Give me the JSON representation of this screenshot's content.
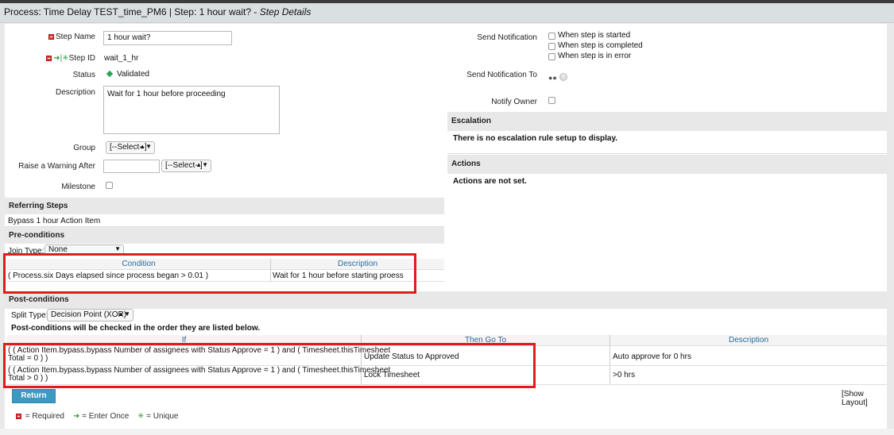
{
  "title": {
    "main": "Process: Time Delay TEST_time_PM6 | Step: 1 hour wait? - ",
    "sub": "Step Details"
  },
  "form": {
    "step_name_label": "Step Name",
    "step_name_value": "1 hour wait?",
    "step_id_label": "Step ID",
    "step_id_value": "wait_1_hr",
    "status_label": "Status",
    "status_value": "Validated",
    "description_label": "Description",
    "description_value": "Wait for 1 hour before proceeding",
    "group_label": "Group",
    "group_value": "[--Select--]",
    "raise_warning_label": "Raise a Warning After",
    "raise_warning_unit": "[--Select--]",
    "milestone_label": "Milestone"
  },
  "right": {
    "send_notification_label": "Send Notification",
    "notify_options": [
      "When step is started",
      "When step is completed",
      "When step is in error"
    ],
    "send_notification_to_label": "Send Notification To",
    "notify_owner_label": "Notify Owner",
    "escalation_title": "Escalation",
    "escalation_text": "There is no escalation rule setup to display.",
    "actions_title": "Actions",
    "actions_text": "Actions are not set."
  },
  "referring": {
    "title": "Referring Steps",
    "item": "Bypass 1 hour Action Item"
  },
  "preconditions": {
    "title": "Pre-conditions",
    "join_type_label": "Join Type:",
    "join_type_value": "None",
    "columns": [
      "Condition",
      "Description"
    ],
    "rows": [
      {
        "condition": "( Process.six Days elapsed since process began > 0.01 )",
        "description": "Wait for 1 hour before starting proess"
      }
    ]
  },
  "postconditions": {
    "title": "Post-conditions",
    "split_type_label": "Split Type:",
    "split_type_value": "Decision Point (XOR)",
    "note": "Post-conditions will be checked in the order they are listed below.",
    "columns": [
      "If",
      "Then Go To",
      "Description"
    ],
    "rows": [
      {
        "if_line1": "( ( Action Item.bypass.bypass Number of assignees with Status Approve = 1 ) and ( Timesheet.thisTimesheet",
        "if_line2": "Total = 0 ) )",
        "then": "Update Status to Approved",
        "description": "Auto approve for 0 hrs"
      },
      {
        "if_line1": "( ( Action Item.bypass.bypass Number of assignees with Status Approve = 1 ) and ( Timesheet.thisTimesheet",
        "if_line2": "Total > 0 ) )",
        "then": "Lock Timesheet",
        "description": ">0 hrs"
      }
    ]
  },
  "footer": {
    "return_label": "Return",
    "show_layout_label": "[Show Layout]",
    "legend_required": "= Required",
    "legend_enter_once": "= Enter Once",
    "legend_unique": "= Unique"
  },
  "colors": {
    "highlight_border": "#e51919",
    "link_blue": "#2a6a9c",
    "button": "#3c9ac1"
  }
}
